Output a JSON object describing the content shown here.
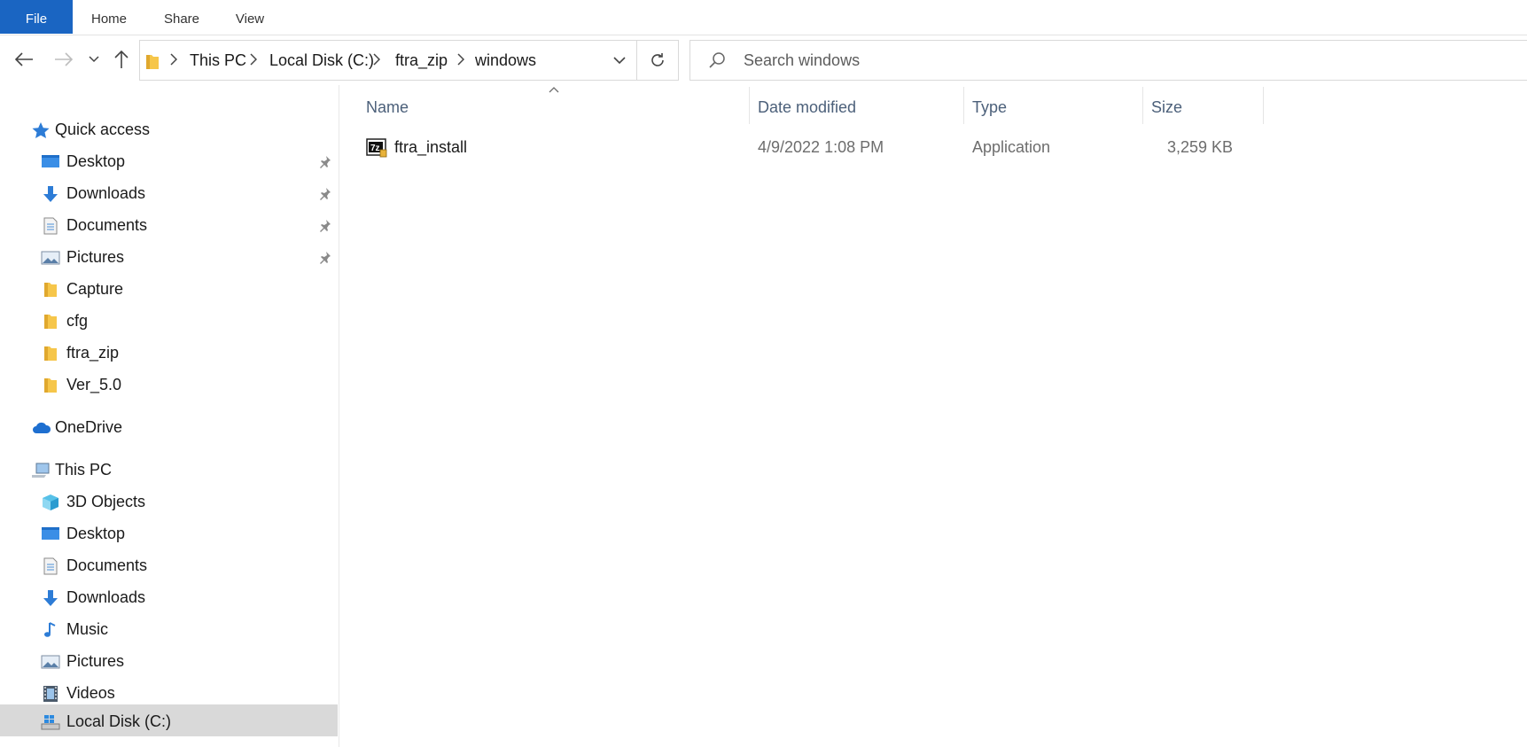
{
  "ribbon": {
    "tabs": [
      "File",
      "Home",
      "Share",
      "View"
    ]
  },
  "address_bar": {
    "breadcrumbs": [
      "This PC",
      "Local Disk (C:)",
      "ftra_zip",
      "windows"
    ]
  },
  "search": {
    "placeholder": "Search windows"
  },
  "sidebar": {
    "quick_access_label": "Quick access",
    "quick_access_items": [
      {
        "label": "Desktop",
        "icon": "desktop-icon",
        "pinned": true
      },
      {
        "label": "Downloads",
        "icon": "download-arrow-icon",
        "pinned": true
      },
      {
        "label": "Documents",
        "icon": "documents-icon",
        "pinned": true
      },
      {
        "label": "Pictures",
        "icon": "pictures-icon",
        "pinned": true
      },
      {
        "label": "Capture",
        "icon": "folder-icon",
        "pinned": false
      },
      {
        "label": "cfg",
        "icon": "folder-icon",
        "pinned": false
      },
      {
        "label": "ftra_zip",
        "icon": "folder-icon",
        "pinned": false
      },
      {
        "label": "Ver_5.0",
        "icon": "folder-icon",
        "pinned": false
      }
    ],
    "onedrive_label": "OneDrive",
    "this_pc_label": "This PC",
    "this_pc_items": [
      {
        "label": "3D Objects",
        "icon": "3d-objects-icon"
      },
      {
        "label": "Desktop",
        "icon": "desktop-icon"
      },
      {
        "label": "Documents",
        "icon": "documents-icon"
      },
      {
        "label": "Downloads",
        "icon": "download-arrow-icon"
      },
      {
        "label": "Music",
        "icon": "music-note-icon"
      },
      {
        "label": "Pictures",
        "icon": "pictures-icon"
      },
      {
        "label": "Videos",
        "icon": "videos-icon"
      },
      {
        "label": "Local Disk (C:)",
        "icon": "local-disk-icon",
        "selected": true
      }
    ]
  },
  "file_list": {
    "columns": [
      "Name",
      "Date modified",
      "Type",
      "Size"
    ],
    "rows": [
      {
        "name": "ftra_install",
        "date_modified": "4/9/2022 1:08 PM",
        "type": "Application",
        "size": "3,259 KB",
        "icon": "7zip-application-icon"
      }
    ]
  },
  "colors": {
    "file_tab": "#1a65c2",
    "selected_item": "#d9d9d9",
    "column_header_text": "#4c607a",
    "folder": "#f6c64a"
  }
}
